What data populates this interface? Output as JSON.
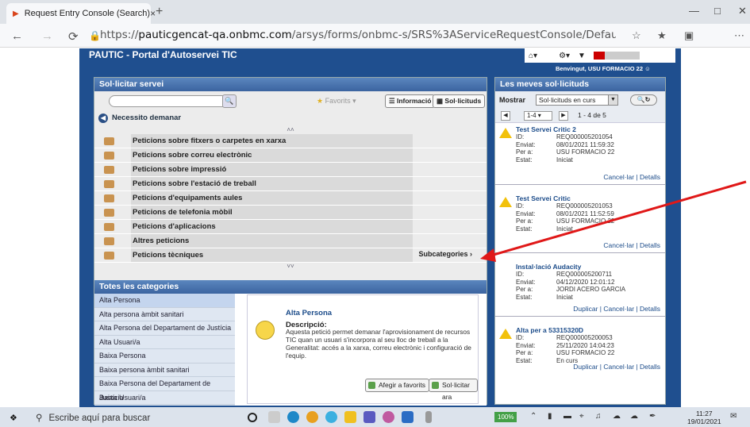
{
  "browser": {
    "tab_title": "Request Entry Console (Search)",
    "tab_close": "×",
    "new_tab": "+",
    "url_scheme": "https://",
    "url_host": "pauticgencat-qa.onbmc.com",
    "url_path": "/arsys/forms/onbmc-s/SRS%3AServiceRequestConsole/Default+Administrator+Vie..."
  },
  "header": {
    "portal_title": "PAUTIC - Portal d'Autoservei TIC",
    "welcome": "Benvingut, USU FORMACIO 22"
  },
  "left": {
    "panel_title": "Sol·licitar servei",
    "favorites": "Favorits",
    "info_button": "Informació",
    "requests_button": "Sol·licituds",
    "need_label": "Necessito demanar",
    "items": [
      {
        "label": "Peticions sobre fitxers o carpetes en xarxa"
      },
      {
        "label": "Peticions sobre correu electrònic"
      },
      {
        "label": "Peticions sobre impressió"
      },
      {
        "label": "Peticions sobre l'estació de treball"
      },
      {
        "label": "Peticions d'equipaments aules"
      },
      {
        "label": "Peticions de telefonia mòbil"
      },
      {
        "label": "Peticions d'aplicacions"
      },
      {
        "label": "Altres peticions"
      },
      {
        "label": "Peticions tècniques"
      }
    ],
    "subcategories": "Subcategories ›",
    "all_categories": "Totes les categories",
    "categories": [
      "Alta Persona",
      "Alta persona àmbit sanitari",
      "Alta Persona del Departament de Justícia",
      "Alta Usuari/a",
      "Baixa Persona",
      "Baixa persona àmbit sanitari",
      "Baixa Persona del Departament de Justícia",
      "Baixa Usuari/a"
    ],
    "detail": {
      "title": "Alta Persona",
      "desc_label": "Descripció:",
      "desc_text": "Aquesta petició permet demanar l'aprovisionament de recursos TIC quan un usuari s'incorpora al seu lloc de treball a la Generalitat: accés a la xarxa, correu electrònic i configuració de l'equip.",
      "fav_button": "Afegir a favorits",
      "request_button": "Sol·licitar ara"
    }
  },
  "right": {
    "panel_title": "Les meves sol·licituds",
    "show_label": "Mostrar",
    "show_value": "Sol·licituds en curs",
    "page_value": "1-4",
    "page_text": "1 - 4 de 5",
    "labels": {
      "id": "ID:",
      "sent": "Enviat:",
      "for": "Per a:",
      "state": "Estat:"
    },
    "requests": [
      {
        "title": "Test Servei Critic 2",
        "id": "REQ000005201054",
        "sent": "08/01/2021 11:59:32",
        "for": "USU FORMACIO 22",
        "state": "Iniciat",
        "actions": "Cancel·lar | Detalls"
      },
      {
        "title": "Test Servei Critic",
        "id": "REQ000005201053",
        "sent": "08/01/2021 11:52:59",
        "for": "USU FORMACIO 22",
        "state": "Iniciat",
        "actions": "Cancel·lar | Detalls"
      },
      {
        "title": "Instal·lació Audacity",
        "id": "REQ000005200711",
        "sent": "04/12/2020 12:01:12",
        "for": "JORDI ACERO GARCIA",
        "state": "Iniciat",
        "actions": "Duplicar | Cancel·lar | Detalls"
      },
      {
        "title": "Alta per a 53315320D",
        "id": "REQ000005200053",
        "sent": "25/11/2020 14:04:23",
        "for": "USU FORMACIO 22",
        "state": "En curs",
        "actions": "Duplicar | Cancel·lar | Detalls"
      }
    ]
  },
  "taskbar": {
    "search_placeholder": "Escribe aquí para buscar",
    "lang": "100%",
    "time": "11:27",
    "date": "19/01/2021"
  }
}
